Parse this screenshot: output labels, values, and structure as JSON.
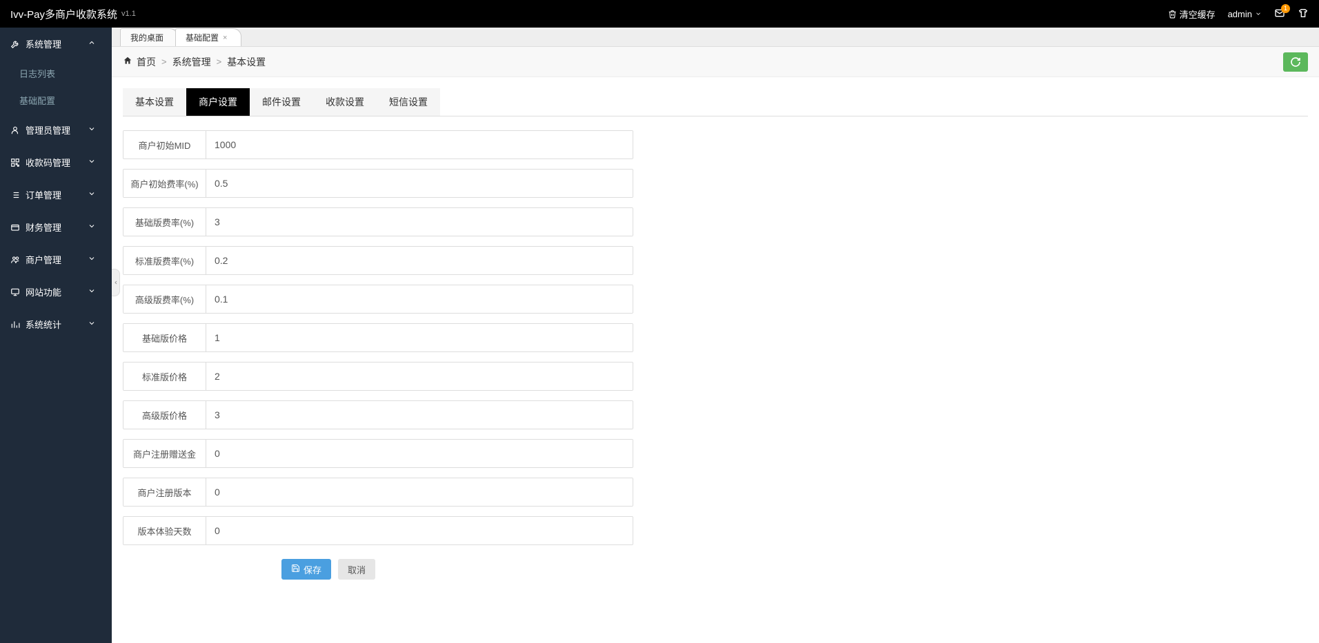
{
  "header": {
    "brand": "Ivv-Pay多商户收款系统",
    "version": "v1.1",
    "clear_cache": "清空缓存",
    "user": "admin",
    "mail_badge": "1"
  },
  "sidebar": {
    "items": [
      {
        "label": "系统管理",
        "expanded": true
      },
      {
        "label": "管理员管理",
        "expanded": false
      },
      {
        "label": "收款码管理",
        "expanded": false
      },
      {
        "label": "订单管理",
        "expanded": false
      },
      {
        "label": "财务管理",
        "expanded": false
      },
      {
        "label": "商户管理",
        "expanded": false
      },
      {
        "label": "网站功能",
        "expanded": false
      },
      {
        "label": "系统统计",
        "expanded": false
      }
    ],
    "sub_items": [
      "日志列表",
      "基础配置"
    ]
  },
  "page_tabs": [
    {
      "label": "我的桌面",
      "closable": false
    },
    {
      "label": "基础配置",
      "closable": true
    }
  ],
  "breadcrumb": {
    "home": "首页",
    "b1": "系统管理",
    "b2": "基本设置"
  },
  "content_tabs": [
    "基本设置",
    "商户设置",
    "邮件设置",
    "收款设置",
    "短信设置"
  ],
  "form": {
    "rows": [
      {
        "label": "商户初始MID",
        "value": "1000"
      },
      {
        "label": "商户初始费率(%)",
        "value": "0.5"
      },
      {
        "label": "基础版费率(%)",
        "value": "3"
      },
      {
        "label": "标准版费率(%)",
        "value": "0.2"
      },
      {
        "label": "高级版费率(%)",
        "value": "0.1"
      },
      {
        "label": "基础版价格",
        "value": "1"
      },
      {
        "label": "标准版价格",
        "value": "2"
      },
      {
        "label": "高级版价格",
        "value": "3"
      },
      {
        "label": "商户注册赠送金",
        "value": "0"
      },
      {
        "label": "商户注册版本",
        "value": "0"
      },
      {
        "label": "版本体验天数",
        "value": "0"
      }
    ],
    "save": "保存",
    "cancel": "取消"
  }
}
